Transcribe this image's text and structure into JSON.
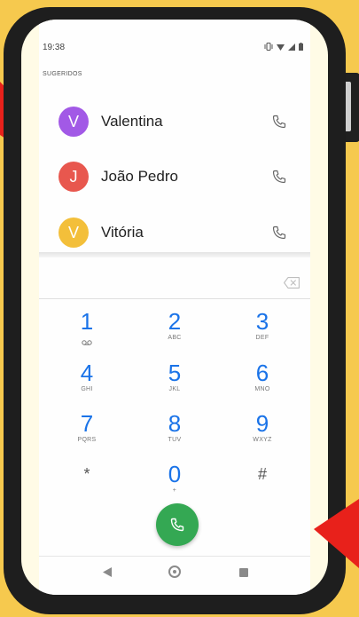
{
  "status_bar": {
    "time": "19:38",
    "icons": [
      "vibrate-icon",
      "wifi-icon",
      "signal-icon",
      "battery-icon"
    ]
  },
  "suggested": {
    "header": "SUGERIDOS",
    "contacts": [
      {
        "initial": "V",
        "name": "Valentina",
        "avatar_color": "#a259e6"
      },
      {
        "initial": "J",
        "name": "João Pedro",
        "avatar_color": "#e8574e"
      },
      {
        "initial": "V",
        "name": "Vitória",
        "avatar_color": "#f3bf3a"
      }
    ]
  },
  "keypad": {
    "keys": [
      {
        "digit": "1",
        "letters": "voicemail"
      },
      {
        "digit": "2",
        "letters": "ABC"
      },
      {
        "digit": "3",
        "letters": "DEF"
      },
      {
        "digit": "4",
        "letters": "GHI"
      },
      {
        "digit": "5",
        "letters": "JKL"
      },
      {
        "digit": "6",
        "letters": "MNO"
      },
      {
        "digit": "7",
        "letters": "PQRS"
      },
      {
        "digit": "8",
        "letters": "TUV"
      },
      {
        "digit": "9",
        "letters": "WXYZ"
      },
      {
        "digit": "*",
        "letters": ""
      },
      {
        "digit": "0",
        "letters": "+"
      },
      {
        "digit": "#",
        "letters": ""
      }
    ]
  },
  "colors": {
    "background": "#f6c94e",
    "accent_blue": "#1a73e8",
    "dial_green": "#34a853",
    "arrow_red": "#e8211b"
  }
}
